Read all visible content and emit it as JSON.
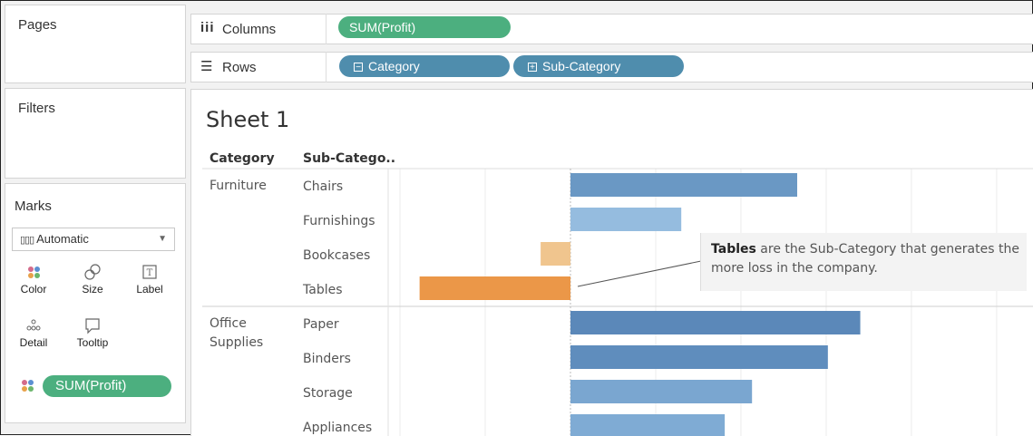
{
  "shelves": {
    "pages_title": "Pages",
    "filters_title": "Filters",
    "columns": {
      "icon": "iii",
      "label": "Columns",
      "pills": [
        "SUM(Profit)"
      ]
    },
    "rows": {
      "icon": "☰",
      "label": "Rows",
      "pills": [
        {
          "sign": "−",
          "label": "Category"
        },
        {
          "sign": "+",
          "label": "Sub-Category"
        }
      ]
    }
  },
  "marks": {
    "title": "Marks",
    "mark_type": "Automatic",
    "buttons": [
      {
        "label": "Color",
        "icon": "color-dots-icon"
      },
      {
        "label": "Size",
        "icon": "size-icon"
      },
      {
        "label": "Label",
        "icon": "label-icon"
      },
      {
        "label": "Detail",
        "icon": "detail-icon"
      },
      {
        "label": "Tooltip",
        "icon": "tooltip-icon"
      }
    ],
    "field_pill": "SUM(Profit)"
  },
  "sheet": {
    "title": "Sheet 1",
    "header_category": "Category",
    "header_subcategory": "Sub-Catego..",
    "categories": [
      "Furniture",
      "Office\nSupplies"
    ]
  },
  "chart_data": {
    "type": "bar",
    "orientation": "horizontal",
    "measure": "SUM(Profit)",
    "rows": [
      {
        "category": "Furniture",
        "sub_category": "Chairs",
        "value": 26600,
        "color": "#6a98c4"
      },
      {
        "category": "Furniture",
        "sub_category": "Furnishings",
        "value": 13000,
        "color": "#95bcdf"
      },
      {
        "category": "Furniture",
        "sub_category": "Bookcases",
        "value": -3500,
        "color": "#f0c58e"
      },
      {
        "category": "Furniture",
        "sub_category": "Tables",
        "value": -17700,
        "color": "#eb9748"
      },
      {
        "category": "Office Supplies",
        "sub_category": "Paper",
        "value": 34000,
        "color": "#5b88b9"
      },
      {
        "category": "Office Supplies",
        "sub_category": "Binders",
        "value": 30200,
        "color": "#5f8dbd"
      },
      {
        "category": "Office Supplies",
        "sub_category": "Storage",
        "value": 21300,
        "color": "#7aa6d0"
      },
      {
        "category": "Office Supplies",
        "sub_category": "Appliances",
        "value": 18100,
        "color": "#7fabd4"
      }
    ],
    "xlim": [
      -20000,
      50000
    ],
    "grid": true
  },
  "annotation": {
    "bold": "Tables",
    "rest": " are the Sub-Category that generates the more loss in the company.",
    "target": "Tables"
  }
}
